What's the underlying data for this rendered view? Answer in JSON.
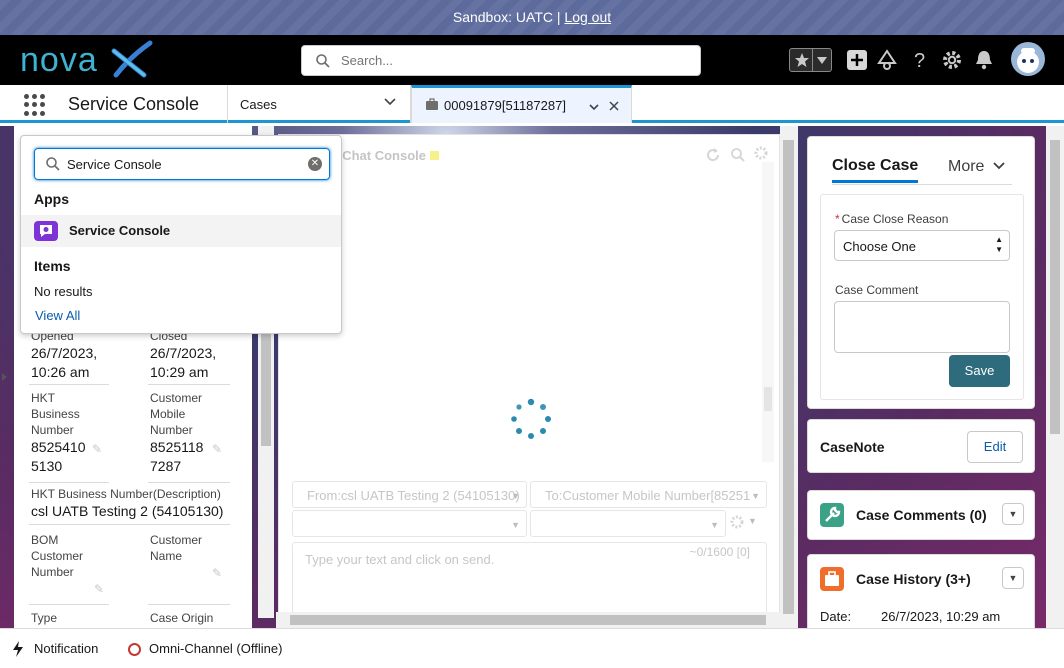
{
  "sandbox": {
    "label": "Sandbox: UATC |",
    "logout": "Log out"
  },
  "header": {
    "logo_text": "novaX",
    "search_placeholder": "Search..."
  },
  "nav": {
    "app_name": "Service Console",
    "cases_tab": "Cases",
    "record_tab": "00091879[51187287]"
  },
  "app_launcher": {
    "search_value": "Service Console",
    "apps_heading": "Apps",
    "app_item": "Service Console",
    "items_heading": "Items",
    "no_results": "No results",
    "view_all": "View All"
  },
  "record": {
    "opened_label": "Opened",
    "opened_value": "26/7/2023, 10:26 am",
    "closed_label": "Closed",
    "closed_value": "26/7/2023, 10:29 am",
    "hkt_business_number_label": "HKT Business Number",
    "hkt_business_number_value": "85254105130",
    "customer_mobile_label": "Customer Mobile Number",
    "customer_mobile_value": "85251187287",
    "hkt_desc_label": "HKT Business Number(Description)",
    "hkt_desc_value": "csl UATB Testing 2 (54105130)",
    "bom_label": "BOM Customer Number",
    "customer_name_label": "Customer Name",
    "type_label": "Type",
    "case_origin_label": "Case Origin"
  },
  "chat": {
    "title": "i Chat Console",
    "from": "From:csl UATB Testing 2 (54105130)",
    "to": "To:Customer Mobile Number[85251",
    "message_placeholder": "Type your text and click on send.",
    "counter": "~0/1600 [0]"
  },
  "close_case": {
    "tab_active": "Close Case",
    "tab_more": "More",
    "reason_label": "Case Close Reason",
    "reason_value": "Choose One",
    "comment_label": "Case Comment",
    "save_label": "Save"
  },
  "case_note": {
    "title": "CaseNote",
    "edit_label": "Edit"
  },
  "case_comments": {
    "title": "Case Comments (0)"
  },
  "case_history": {
    "title": "Case History (3+)",
    "date_label": "Date:",
    "date_value": "26/7/2023, 10:29 am"
  },
  "footer": {
    "notification": "Notification",
    "omni": "Omni-Channel (Offline)"
  },
  "colors": {
    "brand_blue": "#1b96d0",
    "save_button": "#2e6b7c",
    "sandbox_bar": "#5c6a9c",
    "offline_red": "#c23934"
  }
}
